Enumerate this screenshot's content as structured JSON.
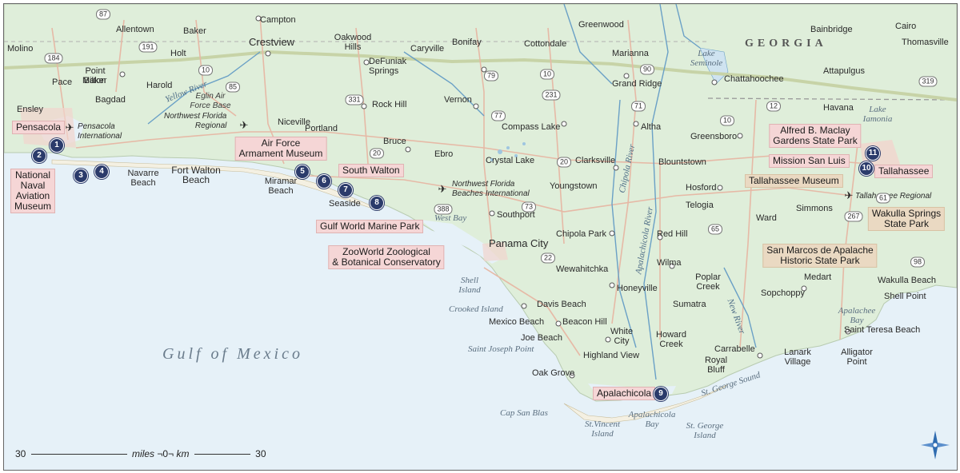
{
  "title_labels": {
    "state": "GEORGIA",
    "gulf": "Gulf of Mexico"
  },
  "water_labels": [
    {
      "id": "west-bay",
      "text": "West Bay"
    },
    {
      "id": "lake-seminole",
      "text": "Lake\nSeminole"
    },
    {
      "id": "lake-iamonia",
      "text": "Lake\nIamonia"
    },
    {
      "id": "apalachee-bay",
      "text": "Apalachee\nBay"
    },
    {
      "id": "st-george-sound",
      "text": "St. George Sound"
    },
    {
      "id": "apalachicola-bay",
      "text": "Apalachicola\nBay"
    },
    {
      "id": "yellow-river",
      "text": "Yellow River"
    },
    {
      "id": "chipola-river",
      "text": "Chipola River"
    },
    {
      "id": "apalachicola-river",
      "text": "Apalachicola River"
    },
    {
      "id": "new-river",
      "text": "New River"
    }
  ],
  "land_labels": [
    {
      "id": "shell-island",
      "text": "Shell\nIsland"
    },
    {
      "id": "crooked-island",
      "text": "Crooked Island"
    },
    {
      "id": "saint-joseph-point",
      "text": "Saint Joseph Point"
    },
    {
      "id": "cap-san-blas",
      "text": "Cap San Blas"
    },
    {
      "id": "st-vincent-island",
      "text": "St.Vincent\nIsland"
    },
    {
      "id": "st-george-island",
      "text": "St. George\nIsland"
    },
    {
      "id": "eglin-afb",
      "text": "Eglin Air\nForce Base"
    }
  ],
  "airports": [
    {
      "id": "pensacola-intl",
      "text": "Pensacola\nInternational"
    },
    {
      "id": "nw-florida-regional",
      "text": "Northwest Florida\nRegional"
    },
    {
      "id": "nw-florida-beaches",
      "text": "Northwest Florida\nBeaches International"
    },
    {
      "id": "tallahassee-regional",
      "text": "Tallahassee Regional"
    }
  ],
  "towns": [
    "Campton",
    "Molino",
    "Allentown",
    "Baker",
    "Crestview",
    "Oakwood\nHills",
    "Bonifay",
    "Cottondale",
    "Greenwood",
    "Bainbridge",
    "Cairo",
    "Thomasville",
    "Point\nBaker",
    "Holt",
    "DeFuniak\nSprings",
    "Caryville",
    "Marianna",
    "Attapulgus",
    "Pace",
    "Milton",
    "Harold",
    "Grand Ridge",
    "Chattahoochee",
    "Bagdad",
    "Rock Hill",
    "Vernon",
    "Ensley",
    "Havana",
    "Pensacola",
    "Niceville",
    "Portland",
    "Altha",
    "Compass Lake",
    "Greensboro",
    "Bruce",
    "Ebro",
    "Crystal Lake",
    "Clarksville",
    "Blountstown",
    "Navarre\nBeach",
    "Fort Walton\nBeach",
    "Miramar\nBeach",
    "Youngstown",
    "Hosford",
    "Seaside",
    "Telogia",
    "Ward",
    "Simmons",
    "Southport",
    "Panama City",
    "Chipola Park",
    "Red Hill",
    "Wewahitchka",
    "Wilma",
    "Poplar\nCreek",
    "Medart",
    "Wakulla Beach",
    "Honeyville",
    "Sopchoppy",
    "Shell Point",
    "Davis Beach",
    "Sumatra",
    "Mexico Beach",
    "Beacon Hill",
    "Joe Beach",
    "White\nCity",
    "Howard\nCreek",
    "Saint Teresa Beach",
    "Carrabelle",
    "Lanark\nVillage",
    "Alligator\nPoint",
    "Highland View",
    "Royal\nBluff",
    "Oak Grove"
  ],
  "attractions": [
    {
      "num": "1",
      "name": "Pensacola"
    },
    {
      "num": "2",
      "name": "National\nNaval\nAviation\nMuseum"
    },
    {
      "num": "5",
      "name": "Air Force\nArmament Museum"
    },
    {
      "num": "6",
      "name": "South Walton"
    },
    {
      "num": "8",
      "name": "Gulf World Marine Park"
    },
    {
      "num": "8",
      "name": "ZooWorld Zoological\n& Botanical Conservatory"
    },
    {
      "num": "9",
      "name": "Apalachicola"
    },
    {
      "num": "11",
      "name": "Alfred B. Maclay\nGardens State Park"
    },
    {
      "num": "10",
      "name": "Mission San Luis"
    },
    {
      "num": "10",
      "name": "Tallahassee"
    },
    {
      "num": "",
      "name": "Tallahassee Museum"
    },
    {
      "num": "",
      "name": "Wakulla Springs\nState Park"
    },
    {
      "num": "",
      "name": "San Marcos de Apalache\nHistoric State Park"
    }
  ],
  "markers": [
    "1",
    "2",
    "3",
    "4",
    "5",
    "6",
    "7",
    "8",
    "9",
    "10",
    "11"
  ],
  "highways": [
    "87",
    "184",
    "191",
    "10",
    "85",
    "331",
    "10",
    "79",
    "77",
    "20",
    "231",
    "388",
    "22",
    "71",
    "73",
    "90",
    "10",
    "65",
    "12",
    "319",
    "61",
    "98",
    "267",
    "20"
  ],
  "scale": {
    "left": "30",
    "middle_miles": "miles",
    "middle_zero": "0",
    "middle_km": "km",
    "right": "30"
  },
  "colors": {
    "land": "#dfeeda",
    "water": "#e6f1f8",
    "road": "#e6b9a6",
    "interstate": "#c7d3a7",
    "river": "#6aa0c6",
    "poi": "#f5d6d6",
    "poi_tan": "#ead9c2",
    "marker": "#2b3b6b"
  }
}
